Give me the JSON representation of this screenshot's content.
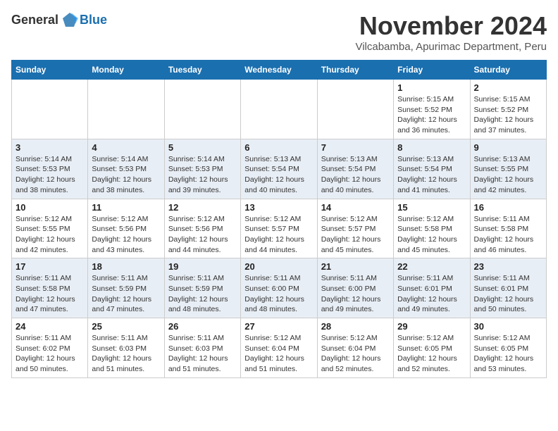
{
  "header": {
    "logo_general": "General",
    "logo_blue": "Blue",
    "month_title": "November 2024",
    "subtitle": "Vilcabamba, Apurimac Department, Peru"
  },
  "weekdays": [
    "Sunday",
    "Monday",
    "Tuesday",
    "Wednesday",
    "Thursday",
    "Friday",
    "Saturday"
  ],
  "weeks": [
    [
      {
        "day": "",
        "info": ""
      },
      {
        "day": "",
        "info": ""
      },
      {
        "day": "",
        "info": ""
      },
      {
        "day": "",
        "info": ""
      },
      {
        "day": "",
        "info": ""
      },
      {
        "day": "1",
        "info": "Sunrise: 5:15 AM\nSunset: 5:52 PM\nDaylight: 12 hours\nand 36 minutes."
      },
      {
        "day": "2",
        "info": "Sunrise: 5:15 AM\nSunset: 5:52 PM\nDaylight: 12 hours\nand 37 minutes."
      }
    ],
    [
      {
        "day": "3",
        "info": "Sunrise: 5:14 AM\nSunset: 5:53 PM\nDaylight: 12 hours\nand 38 minutes."
      },
      {
        "day": "4",
        "info": "Sunrise: 5:14 AM\nSunset: 5:53 PM\nDaylight: 12 hours\nand 38 minutes."
      },
      {
        "day": "5",
        "info": "Sunrise: 5:14 AM\nSunset: 5:53 PM\nDaylight: 12 hours\nand 39 minutes."
      },
      {
        "day": "6",
        "info": "Sunrise: 5:13 AM\nSunset: 5:54 PM\nDaylight: 12 hours\nand 40 minutes."
      },
      {
        "day": "7",
        "info": "Sunrise: 5:13 AM\nSunset: 5:54 PM\nDaylight: 12 hours\nand 40 minutes."
      },
      {
        "day": "8",
        "info": "Sunrise: 5:13 AM\nSunset: 5:54 PM\nDaylight: 12 hours\nand 41 minutes."
      },
      {
        "day": "9",
        "info": "Sunrise: 5:13 AM\nSunset: 5:55 PM\nDaylight: 12 hours\nand 42 minutes."
      }
    ],
    [
      {
        "day": "10",
        "info": "Sunrise: 5:12 AM\nSunset: 5:55 PM\nDaylight: 12 hours\nand 42 minutes."
      },
      {
        "day": "11",
        "info": "Sunrise: 5:12 AM\nSunset: 5:56 PM\nDaylight: 12 hours\nand 43 minutes."
      },
      {
        "day": "12",
        "info": "Sunrise: 5:12 AM\nSunset: 5:56 PM\nDaylight: 12 hours\nand 44 minutes."
      },
      {
        "day": "13",
        "info": "Sunrise: 5:12 AM\nSunset: 5:57 PM\nDaylight: 12 hours\nand 44 minutes."
      },
      {
        "day": "14",
        "info": "Sunrise: 5:12 AM\nSunset: 5:57 PM\nDaylight: 12 hours\nand 45 minutes."
      },
      {
        "day": "15",
        "info": "Sunrise: 5:12 AM\nSunset: 5:58 PM\nDaylight: 12 hours\nand 45 minutes."
      },
      {
        "day": "16",
        "info": "Sunrise: 5:11 AM\nSunset: 5:58 PM\nDaylight: 12 hours\nand 46 minutes."
      }
    ],
    [
      {
        "day": "17",
        "info": "Sunrise: 5:11 AM\nSunset: 5:58 PM\nDaylight: 12 hours\nand 47 minutes."
      },
      {
        "day": "18",
        "info": "Sunrise: 5:11 AM\nSunset: 5:59 PM\nDaylight: 12 hours\nand 47 minutes."
      },
      {
        "day": "19",
        "info": "Sunrise: 5:11 AM\nSunset: 5:59 PM\nDaylight: 12 hours\nand 48 minutes."
      },
      {
        "day": "20",
        "info": "Sunrise: 5:11 AM\nSunset: 6:00 PM\nDaylight: 12 hours\nand 48 minutes."
      },
      {
        "day": "21",
        "info": "Sunrise: 5:11 AM\nSunset: 6:00 PM\nDaylight: 12 hours\nand 49 minutes."
      },
      {
        "day": "22",
        "info": "Sunrise: 5:11 AM\nSunset: 6:01 PM\nDaylight: 12 hours\nand 49 minutes."
      },
      {
        "day": "23",
        "info": "Sunrise: 5:11 AM\nSunset: 6:01 PM\nDaylight: 12 hours\nand 50 minutes."
      }
    ],
    [
      {
        "day": "24",
        "info": "Sunrise: 5:11 AM\nSunset: 6:02 PM\nDaylight: 12 hours\nand 50 minutes."
      },
      {
        "day": "25",
        "info": "Sunrise: 5:11 AM\nSunset: 6:03 PM\nDaylight: 12 hours\nand 51 minutes."
      },
      {
        "day": "26",
        "info": "Sunrise: 5:11 AM\nSunset: 6:03 PM\nDaylight: 12 hours\nand 51 minutes."
      },
      {
        "day": "27",
        "info": "Sunrise: 5:12 AM\nSunset: 6:04 PM\nDaylight: 12 hours\nand 51 minutes."
      },
      {
        "day": "28",
        "info": "Sunrise: 5:12 AM\nSunset: 6:04 PM\nDaylight: 12 hours\nand 52 minutes."
      },
      {
        "day": "29",
        "info": "Sunrise: 5:12 AM\nSunset: 6:05 PM\nDaylight: 12 hours\nand 52 minutes."
      },
      {
        "day": "30",
        "info": "Sunrise: 5:12 AM\nSunset: 6:05 PM\nDaylight: 12 hours\nand 53 minutes."
      }
    ]
  ]
}
